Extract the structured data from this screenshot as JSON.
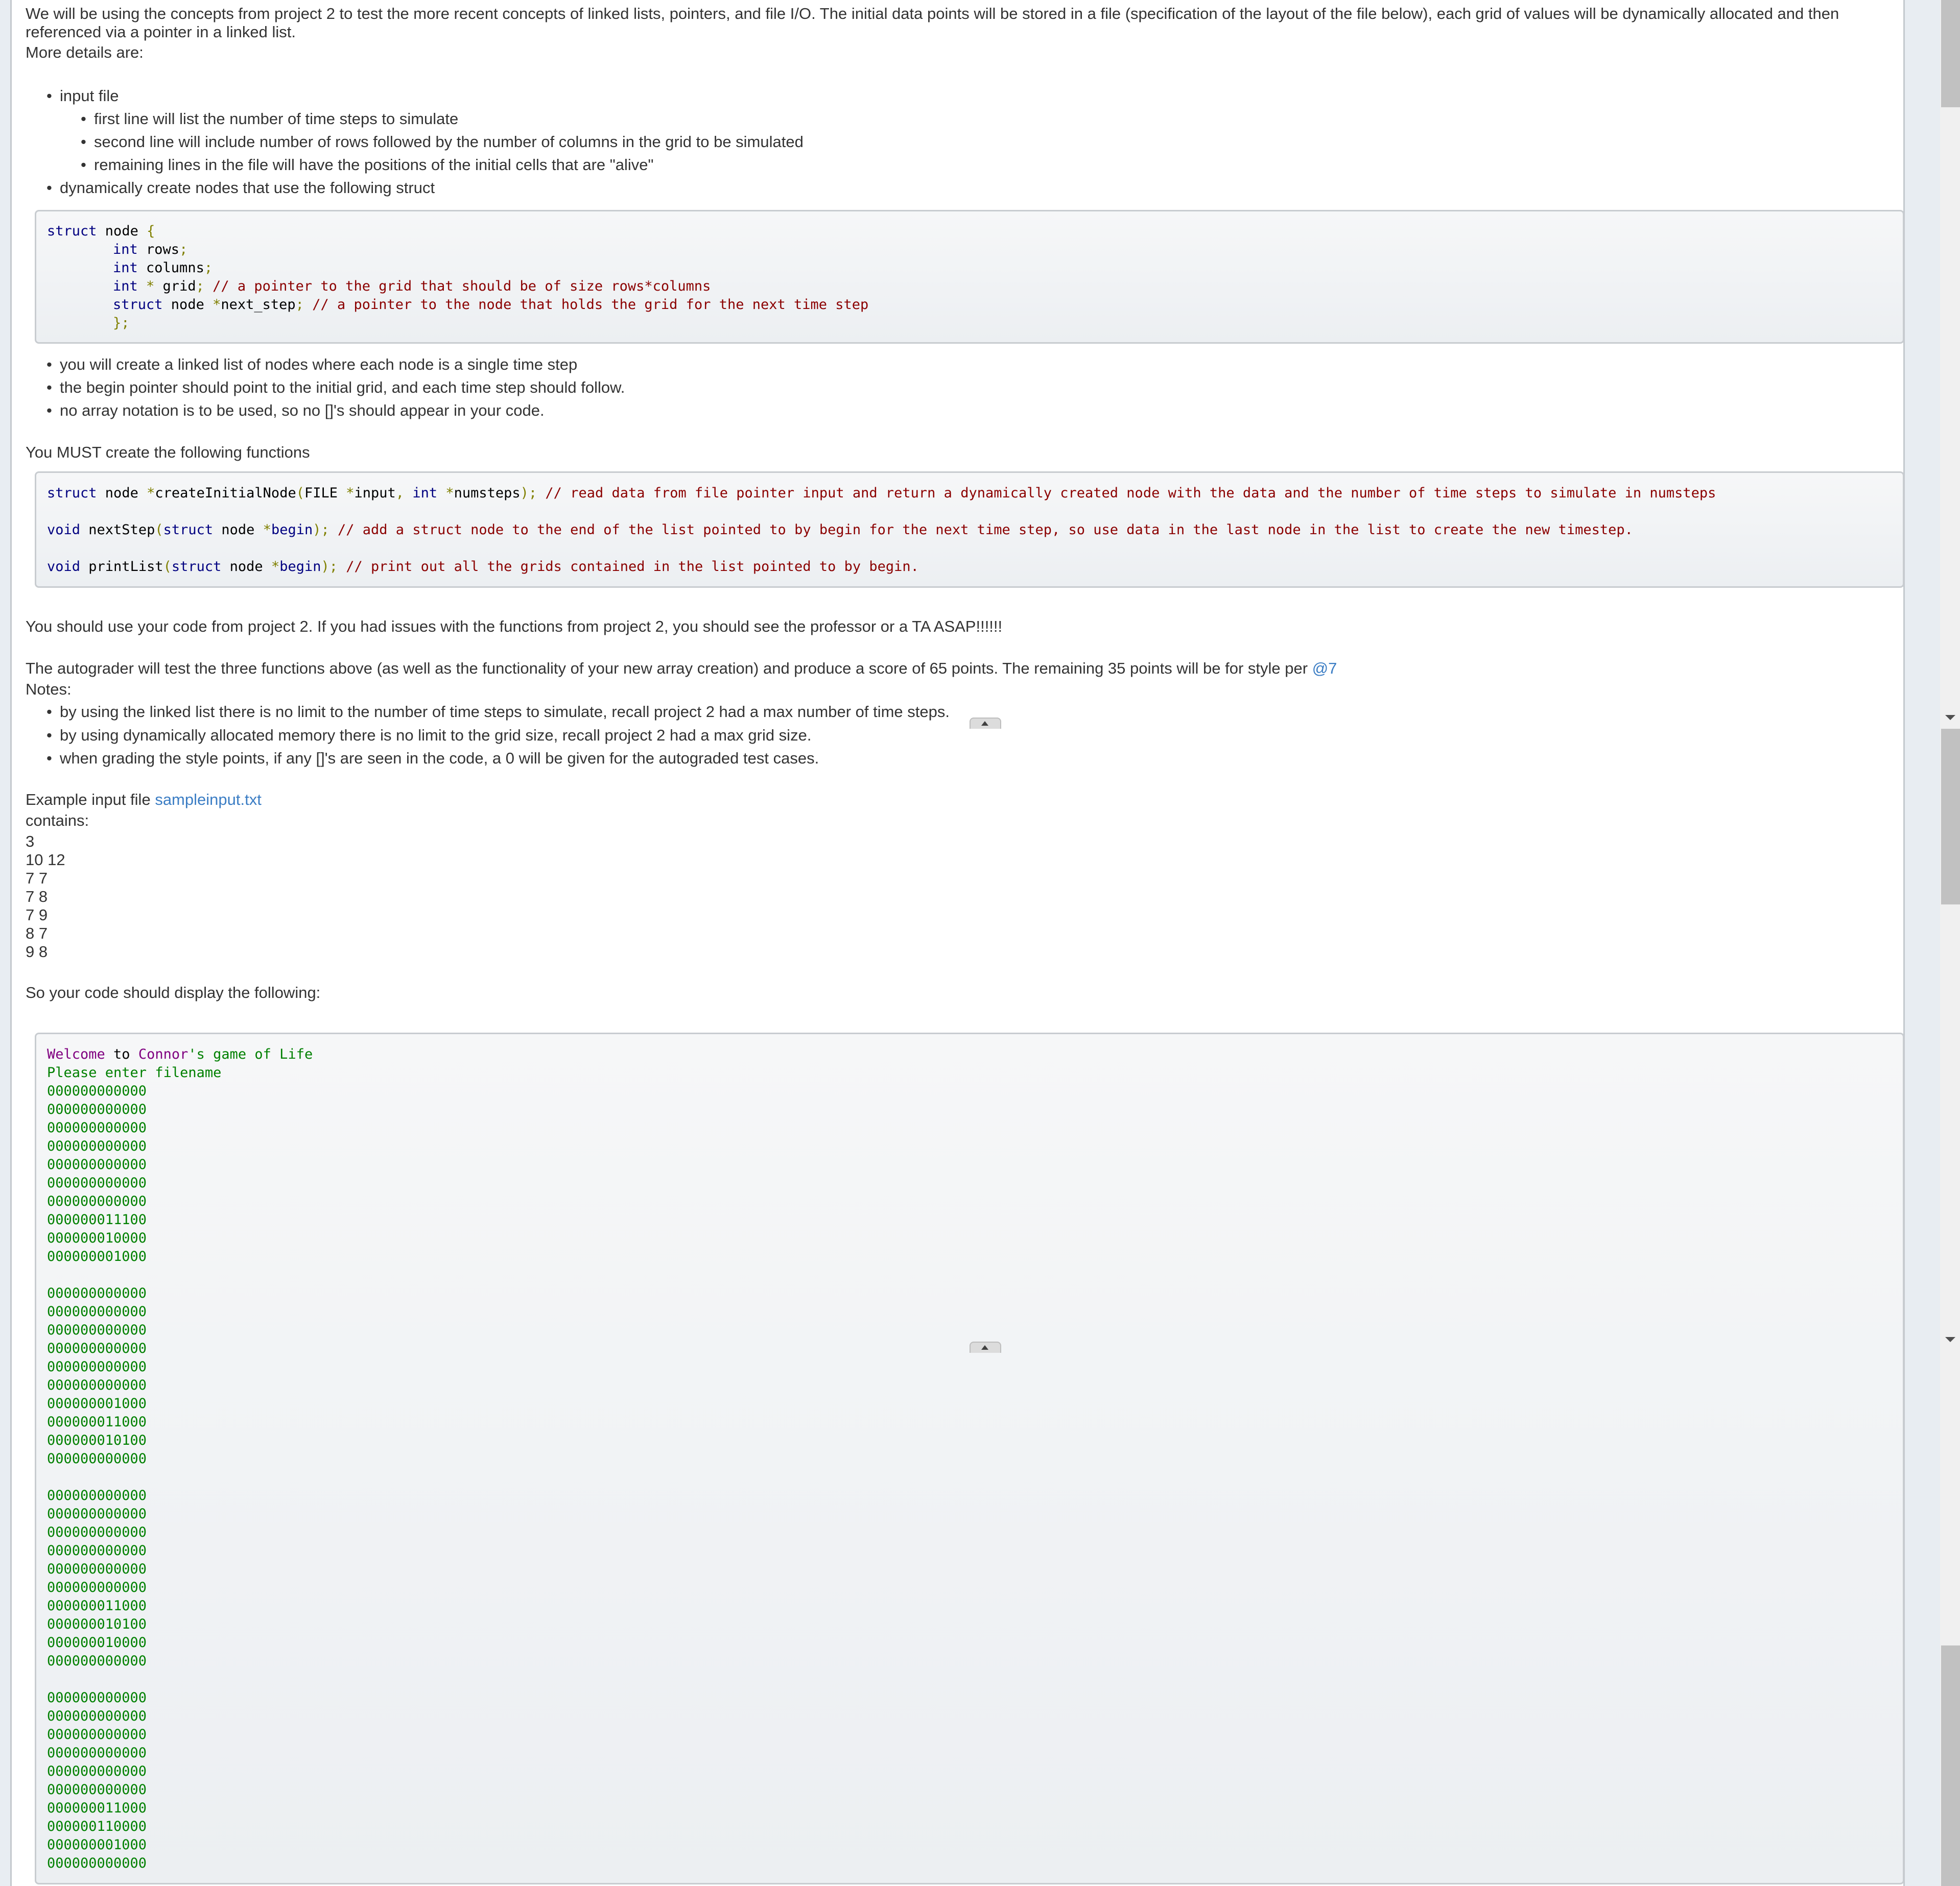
{
  "intro": {
    "paragraph": "We will be using the concepts from project 2 to test the more recent concepts of linked lists, pointers, and file I/O. The initial data points will be stored in a file (specification of the layout of the file below), each grid of values will be dynamically allocated and then referenced via a pointer in a linked list.",
    "more_details": "More details are:"
  },
  "details": {
    "input_file": "input file",
    "input_sub": [
      "first line will list the number of time steps to simulate",
      "second line will include number of rows followed by the number of columns in the grid to be simulated",
      "remaining lines in the file will have the positions of the initial cells that are \"alive\""
    ],
    "dynamic_nodes": "dynamically create nodes that use the following struct"
  },
  "struct_code": {
    "l1_kw": "struct",
    "l1_name": " node ",
    "l1_brace": "{",
    "l2_kw": "int",
    "l2_rest": " rows",
    "l2_semi": ";",
    "l3_kw": "int",
    "l3_rest": " columns",
    "l3_semi": ";",
    "l4_kw": "int",
    "l4_star": " *",
    "l4_rest": " grid",
    "l4_semi": ";",
    "l4_comment": " // a pointer to the grid that should be of size rows*columns",
    "l5_kw": "struct",
    "l5_rest": " node ",
    "l5_star": "*",
    "l5_name": "next_step",
    "l5_semi": ";",
    "l5_comment": " // a pointer to the node that holds the grid for the next time step",
    "l6": "};"
  },
  "list_bullets": [
    "you will create a linked list of nodes where each node is a single time step",
    "the begin pointer should point to the initial grid, and each time step should follow.",
    "no array notation is to be used, so no []'s should appear in your code."
  ],
  "must_create": "You MUST create the following functions",
  "functions": {
    "f1": {
      "kw": "struct",
      "a": " node ",
      "star": "*",
      "name": "createInitialNode",
      "p1": "(",
      "t1": "FILE ",
      "s1": "*",
      "a1": "input",
      "c": ", ",
      "kw2": "int",
      "s2": " *",
      "a2": "numsteps",
      "p2": ");",
      "comment": " // read data from file pointer input and return a dynamically created node with the data and the number of time steps to simulate in numsteps"
    },
    "f2": {
      "kw": "void",
      "name": " nextStep",
      "p1": "(",
      "kw2": "struct",
      "a": " node ",
      "star": "*",
      "arg": "begin",
      "p2": ");",
      "comment": " // add a struct node to the end of the list pointed to by begin for the next time step, so use data in the last node in the list to create the new timestep."
    },
    "f3": {
      "kw": "void",
      "name": " printList",
      "p1": "(",
      "kw2": "struct",
      "a": " node ",
      "star": "*",
      "arg": "begin",
      "p2": ");",
      "comment": " // print out all the grids contained in the list pointed to by begin."
    }
  },
  "use_code": "You should use your code from project 2. If you had issues with the functions from project 2, you should see the professor or a TA ASAP!!!!!!",
  "autograder": {
    "text": "The autograder will test the three functions above (as well as the functionality of your new array creation) and produce a score of 65 points. The remaining 35 points will be for style per ",
    "link": "@7"
  },
  "notes": {
    "label": "Notes:",
    "items": [
      "by using the linked list there is no limit to the number of time steps to simulate, recall project 2 had a max number of time steps.",
      "by using dynamically allocated memory there is no limit to the grid size, recall project 2 had a max grid size.",
      "when grading the style points, if any []'s are seen in the code, a 0 will be given for the autograded test cases."
    ]
  },
  "example": {
    "label": "Example input file ",
    "link": "sampleinput.txt",
    "contains": "contains:",
    "lines": [
      "3",
      "10 12",
      "7 7",
      "7 8",
      "7 9",
      "8 7",
      "9 8"
    ]
  },
  "display_intro": "So your code should display the following:",
  "output": {
    "welcome_a": "Welcome",
    "welcome_b": " to ",
    "welcome_c": "Connor",
    "welcome_d": "'s game of Life",
    "prompt": "Please enter filename",
    "grids": [
      [
        "000000000000",
        "000000000000",
        "000000000000",
        "000000000000",
        "000000000000",
        "000000000000",
        "000000000000",
        "000000011100",
        "000000010000",
        "000000001000"
      ],
      [
        "000000000000",
        "000000000000",
        "000000000000",
        "000000000000",
        "000000000000",
        "000000000000",
        "000000001000",
        "000000011000",
        "000000010100",
        "000000000000"
      ],
      [
        "000000000000",
        "000000000000",
        "000000000000",
        "000000000000",
        "000000000000",
        "000000000000",
        "000000011000",
        "000000010100",
        "000000010000",
        "000000000000"
      ],
      [
        "000000000000",
        "000000000000",
        "000000000000",
        "000000000000",
        "000000000000",
        "000000000000",
        "000000011000",
        "000000110000",
        "000000001000",
        "000000000000"
      ]
    ]
  }
}
